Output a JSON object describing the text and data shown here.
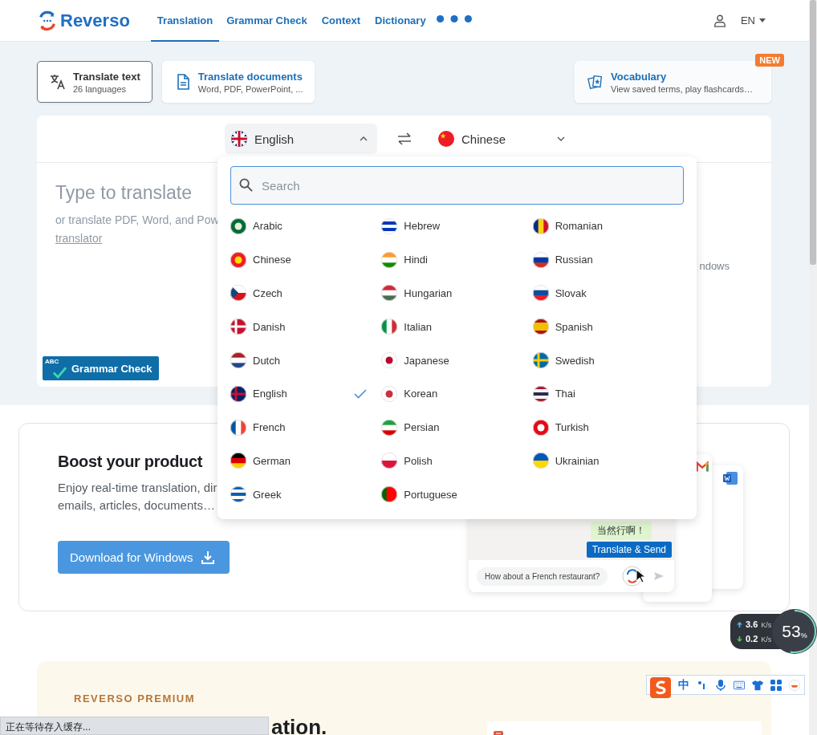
{
  "header": {
    "logo": "Reverso",
    "nav": [
      {
        "label": "Translation",
        "selected": true
      },
      {
        "label": "Grammar Check",
        "selected": false
      },
      {
        "label": "Context",
        "selected": false
      },
      {
        "label": "Dictionary",
        "selected": false
      }
    ],
    "language": "EN"
  },
  "modes": [
    {
      "title": "Translate text",
      "subtitle": "26 languages",
      "selected": true
    },
    {
      "title": "Translate documents",
      "subtitle": "Word, PDF, PowerPoint, ...",
      "selected": false
    }
  ],
  "vocabulary": {
    "title": "Vocabulary",
    "subtitle": "View saved terms, play flashcards…",
    "badge": "NEW"
  },
  "translator": {
    "source": {
      "label": "English",
      "expanded": true
    },
    "target": {
      "label": "Chinese",
      "expanded": false
    },
    "placeholder": "Type to translate",
    "hint": "or translate PDF, Word, and Pow",
    "hint_link": "translator",
    "grammar_icon_text": "ABC",
    "grammar_button": "Grammar Check",
    "right_text": "ndows"
  },
  "language_menu": {
    "search_placeholder": "Search",
    "columns": [
      [
        {
          "label": "Arabic",
          "selected": false
        },
        {
          "label": "Chinese",
          "selected": false
        },
        {
          "label": "Czech",
          "selected": false
        },
        {
          "label": "Danish",
          "selected": false
        },
        {
          "label": "Dutch",
          "selected": false
        },
        {
          "label": "English",
          "selected": true
        },
        {
          "label": "French",
          "selected": false
        },
        {
          "label": "German",
          "selected": false
        },
        {
          "label": "Greek",
          "selected": false
        }
      ],
      [
        {
          "label": "Hebrew",
          "selected": false
        },
        {
          "label": "Hindi",
          "selected": false
        },
        {
          "label": "Hungarian",
          "selected": false
        },
        {
          "label": "Italian",
          "selected": false
        },
        {
          "label": "Japanese",
          "selected": false
        },
        {
          "label": "Korean",
          "selected": false
        },
        {
          "label": "Persian",
          "selected": false
        },
        {
          "label": "Polish",
          "selected": false
        },
        {
          "label": "Portuguese",
          "selected": false
        }
      ],
      [
        {
          "label": "Romanian",
          "selected": false
        },
        {
          "label": "Russian",
          "selected": false
        },
        {
          "label": "Slovak",
          "selected": false
        },
        {
          "label": "Spanish",
          "selected": false
        },
        {
          "label": "Swedish",
          "selected": false
        },
        {
          "label": "Thai",
          "selected": false
        },
        {
          "label": "Turkish",
          "selected": false
        },
        {
          "label": "Ukrainian",
          "selected": false
        }
      ]
    ]
  },
  "promo": {
    "title": "Boost your product",
    "body": [
      "Enjoy real-time translation, dir",
      "emails, articles, documents…"
    ],
    "button": "Download for Windows",
    "chat_reply": "当然行啊！",
    "tooltip": "Translate & Send",
    "chat_input": "How about a French restaurant?"
  },
  "premium": {
    "eyebrow": "REVERSO PREMIUM",
    "title": "ation."
  },
  "net_meter": {
    "up": "3.6",
    "up_unit": "K/s",
    "down": "0.2",
    "down_unit": "K/s",
    "percent": "53",
    "percent_sign": "%"
  },
  "ime_toolbar": {
    "mode": "中"
  },
  "status_bar": "正在等待存入缓存..."
}
